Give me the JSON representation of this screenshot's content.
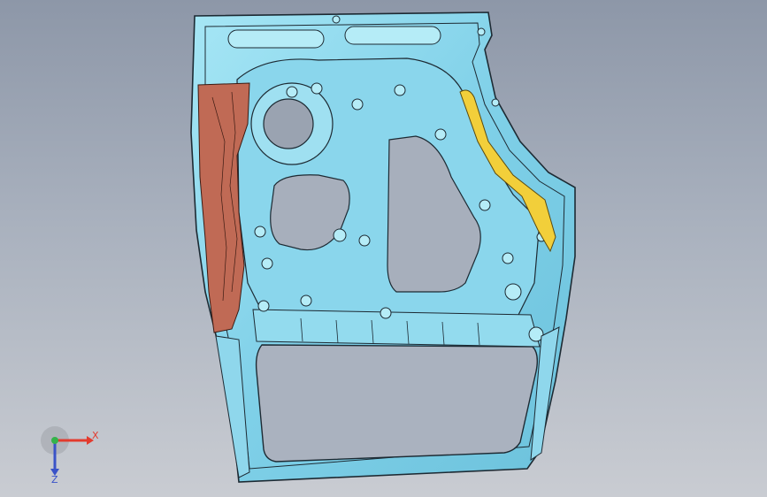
{
  "viewport": {
    "background_top": "#8d97a8",
    "background_bottom": "#c9ccd2"
  },
  "model": {
    "part_color": "#7fd0e8",
    "part_highlight": "#b5ecf7",
    "edge_color": "#1d2a33",
    "reinforcement_color": "#c06a55",
    "seal_color": "#f2cf3a"
  },
  "triad": {
    "x_label": "X",
    "z_label": "Z",
    "x_color": "#e33b2e",
    "y_color": "#34b34a",
    "z_color": "#3a53c8"
  }
}
